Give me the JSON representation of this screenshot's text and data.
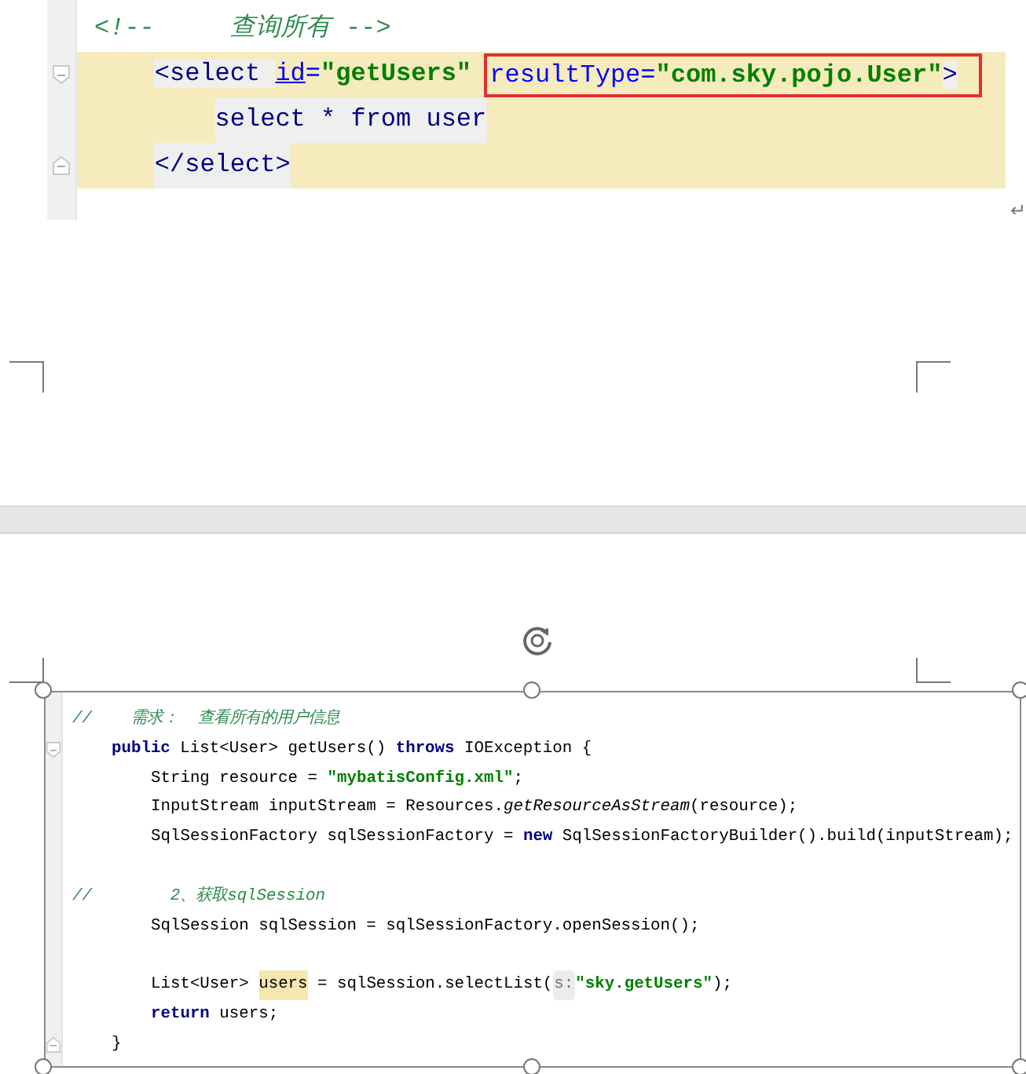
{
  "code_snippet_top": {
    "lines": [
      {
        "kind": "comment",
        "current": false,
        "tokens": [
          {
            "kind": "comment",
            "text": "<!--     查询所有 -->"
          }
        ]
      },
      {
        "kind": "code",
        "current": true,
        "fold": {
          "kind": "open"
        },
        "tokens": [
          {
            "kind": "tag",
            "text": "<select "
          },
          {
            "kind": "attr_underlined",
            "text": "id"
          },
          {
            "kind": "attr",
            "text": "="
          },
          {
            "kind": "string",
            "text": "\"getUsers\" "
          },
          {
            "kind": "attr",
            "text": "resultType=",
            "outlined": true
          },
          {
            "kind": "string",
            "text": "\"com.sky.pojo.User\"",
            "outlined": true
          },
          {
            "kind": "tag",
            "text": ">",
            "outlined": true
          }
        ],
        "children": [
          {
            "kind": "code",
            "current": true,
            "tokens": [
              {
                "kind": "tag",
                "text": "select * from user"
              }
            ]
          }
        ]
      },
      {
        "kind": "code",
        "current": true,
        "fold": {
          "kind": "close"
        },
        "tokens": [
          {
            "kind": "tag",
            "text": "</select>"
          }
        ]
      }
    ]
  },
  "paragraph_mark": "↵",
  "code_snippet_bottom": {
    "selected": true,
    "lines": [
      {
        "kind": "comment",
        "tokens": [
          {
            "kind": "comment",
            "text": "//    需求：  查看所有的用户信息"
          }
        ]
      },
      {
        "kind": "code",
        "fold": {
          "kind": "open"
        },
        "tokens": [
          {
            "kind": "keyword",
            "text": "public"
          },
          {
            "kind": "plain",
            "text": " List<User> getUsers() "
          },
          {
            "kind": "keyword",
            "text": "throws"
          },
          {
            "kind": "plain",
            "text": " IOException {"
          }
        ],
        "children": [
          {
            "kind": "code",
            "tokens": [
              {
                "kind": "plain",
                "text": "String resource = "
              },
              {
                "kind": "string",
                "text": "\"mybatisConfig.xml\""
              },
              {
                "kind": "plain",
                "text": ";"
              }
            ]
          },
          {
            "kind": "code",
            "tokens": [
              {
                "kind": "plain",
                "text": "InputStream inputStream = Resources."
              },
              {
                "kind": "method",
                "text": "getResourceAsStream"
              },
              {
                "kind": "plain",
                "text": "(resource);"
              }
            ]
          },
          {
            "kind": "code",
            "tokens": [
              {
                "kind": "plain",
                "text": "SqlSessionFactory sqlSessionFactory = "
              },
              {
                "kind": "keyword",
                "text": "new"
              },
              {
                "kind": "plain",
                "text": " SqlSessionFactoryBuilder().build(inputStream);"
              }
            ]
          },
          {
            "kind": "blank"
          },
          {
            "kind": "comment",
            "tokens": [
              {
                "kind": "comment",
                "text": "//        2、获取sqlSession"
              }
            ]
          },
          {
            "kind": "code",
            "tokens": [
              {
                "kind": "plain",
                "text": "SqlSession sqlSession = sqlSessionFactory.openSession();"
              }
            ]
          },
          {
            "kind": "blank"
          },
          {
            "kind": "code",
            "tokens": [
              {
                "kind": "plain",
                "text": "List<User> "
              },
              {
                "kind": "usage",
                "text": "users"
              },
              {
                "kind": "plain",
                "text": " = sqlSession.selectList("
              },
              {
                "kind": "hint",
                "text": "s:"
              },
              {
                "kind": "string",
                "text": "\"sky.getUsers\""
              },
              {
                "kind": "plain",
                "text": ");"
              }
            ]
          },
          {
            "kind": "code",
            "tokens": [
              {
                "kind": "keyword",
                "text": "return"
              },
              {
                "kind": "plain",
                "text": " users;"
              }
            ]
          }
        ]
      },
      {
        "kind": "code",
        "fold": {
          "kind": "close"
        },
        "tokens": [
          {
            "kind": "plain",
            "text": "}"
          }
        ]
      }
    ]
  }
}
